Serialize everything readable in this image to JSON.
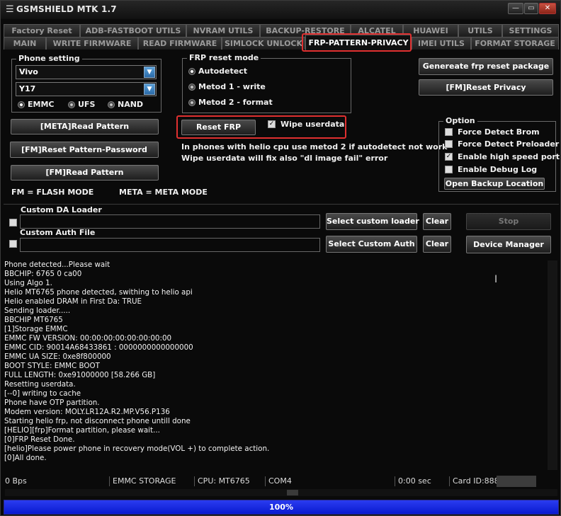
{
  "window": {
    "title": "GSMSHIELD MTK 1.7",
    "menu_glyph": "☰",
    "min_glyph": "—",
    "max_glyph": "▭",
    "close_glyph": "✕"
  },
  "tabs_row1": [
    "Factory Reset",
    "ADB-FASTBOOT UTILS",
    "NVRAM UTILS",
    "BACKUP-RESTORE",
    "ALCATEL",
    "HUAWEI",
    "UTILS",
    "SETTINGS"
  ],
  "tabs_row2": [
    "MAIN",
    "WRITE FIRMWARE",
    "READ FIRMWARE",
    "SIMLOCK UNLOCK",
    "FRP-PATTERN-PRIVACY",
    "IMEI UTILS",
    "FORMAT STORAGE"
  ],
  "active_tab": "FRP-PATTERN-PRIVACY",
  "phone_setting": {
    "legend": "Phone setting",
    "brand": "Vivo",
    "model": "Y17",
    "storage_options": [
      "EMMC",
      "UFS",
      "NAND"
    ],
    "storage_selected": "EMMC"
  },
  "frp_mode": {
    "legend": "FRP reset mode",
    "options": [
      "Autodetect",
      "Metod 1 - write",
      "Metod 2 - format"
    ],
    "selected": "Autodetect"
  },
  "buttons": {
    "meta_read_pattern": "[META]Read Pattern",
    "fm_reset_pattern": "[FM]Reset Pattern-Password",
    "fm_read_pattern": "[FM]Read Pattern",
    "reset_frp": "Reset FRP",
    "gen_frp_package": "Genereate frp reset package",
    "fm_reset_privacy": "[FM]Reset Privacy",
    "select_custom_loader": "Select custom loader",
    "clear1": "Clear",
    "select_custom_auth": "Select Custom Auth",
    "clear2": "Clear",
    "stop": "Stop",
    "device_manager": "Device Manager",
    "open_backup": "Open Backup Location"
  },
  "wipe_userdata": {
    "label": "Wipe userdata",
    "checked": true
  },
  "notes": {
    "helio_line1": "In phones with helio cpu use metod 2 if autodetect not work",
    "helio_line2": "Wipe userdata will fix also \"dl image fail\" error",
    "fm": "FM = FLASH MODE",
    "meta": "META = META MODE"
  },
  "option": {
    "legend": "Option",
    "items": [
      {
        "label": "Force Detect Brom",
        "checked": false
      },
      {
        "label": "Force Detect Preloader",
        "checked": false
      },
      {
        "label": "Enable high speed port",
        "checked": true
      },
      {
        "label": "Enable Debug Log",
        "checked": false
      }
    ]
  },
  "custom": {
    "da_label": "Custom DA Loader",
    "auth_label": "Custom Auth File",
    "da_value": "",
    "auth_value": ""
  },
  "log": [
    "Phone detected...Please wait",
    "BBCHIP: 6765 0 ca00",
    "Using Algo 1.",
    "Helio MT6765 phone detected, swithing to helio api",
    "Helio enabled DRAM in First Da: TRUE",
    "Sending loader.....",
    "BBCHIP MT6765",
    "[1]Storage EMMC",
    "EMMC FW VERSION: 00:00:00:00:00:00:00:00",
    "EMMC CID: 90014A68433861 : 0000000000000000",
    "EMMC UA SIZE: 0xe8f800000",
    "BOOT STYLE: EMMC BOOT",
    "FULL LENGTH: 0xe91000000      [58.266 GB]",
    "Resetting userdata.",
    "[--0] writing to cache",
    "Phone have OTP partition.",
    "Modem version: MOLY.LR12A.R2.MP.V56.P136",
    "Starting helio frp, not disconnect phone untill done",
    "[HELIO][frp]Format partition, please wait...",
    "[0]FRP Reset Done.",
    "[helio]Please power phone in recovery mode(VOL +) to complete action.",
    "[0]All done."
  ],
  "status": {
    "speed": "0 Bps",
    "storage": "EMMC STORAGE",
    "cpu": "CPU: MT6765",
    "port": "COM4",
    "time": "0:00 sec",
    "card_id": "Card ID:888"
  },
  "progress": {
    "value": 1.0,
    "label": "100%"
  }
}
